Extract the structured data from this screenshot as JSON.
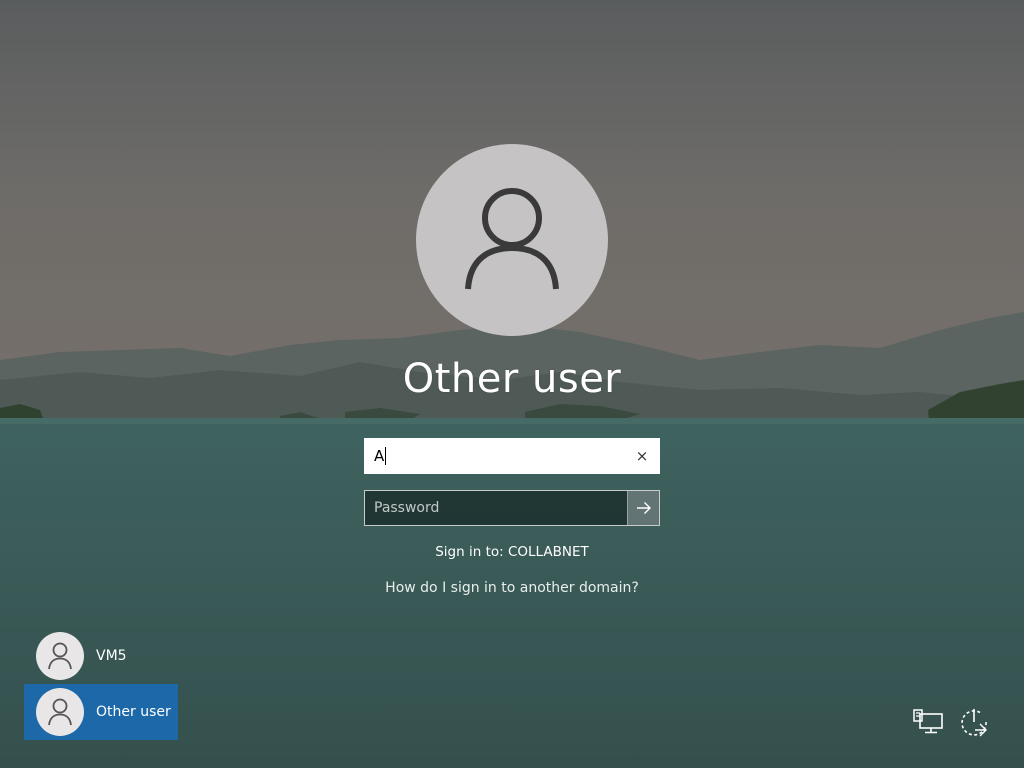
{
  "colors": {
    "selected_user_bg": "#1c68a8",
    "avatar_bg": "#c5c3c3",
    "text": "#ffffff"
  },
  "selected_user": {
    "title": "Other user"
  },
  "sign_in_form": {
    "username_value": "A",
    "clear_icon": "×",
    "password_placeholder": "Password",
    "submit_icon": "arrow-right-icon",
    "sign_in_to": "Sign in to: COLLABNET",
    "domain_help_link": "How do I sign in to another domain?"
  },
  "user_list": [
    {
      "name": "VM5",
      "selected": false
    },
    {
      "name": "Other user",
      "selected": true
    }
  ],
  "system_icons": [
    {
      "name": "network-icon"
    },
    {
      "name": "power-icon"
    }
  ]
}
